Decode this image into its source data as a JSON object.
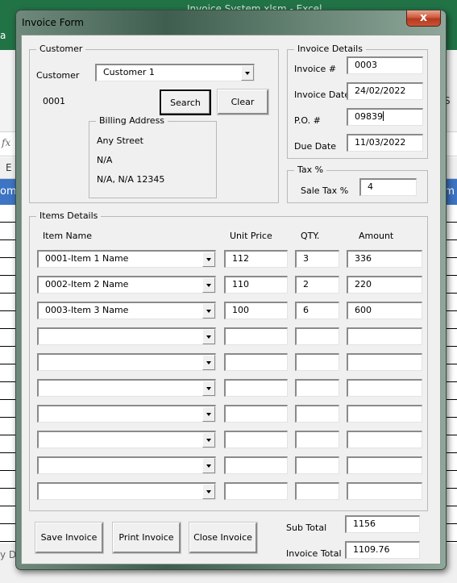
{
  "excel": {
    "title": "Invoice System.xlsm  -  Excel",
    "fragments": {
      "left_tab": "a",
      "formula_icon": "fx",
      "column_e": "E",
      "header_left": "om",
      "header_right": "m",
      "status_left": "y D",
      "ribbon_right_1": "s",
      "ribbon_right_2": "S"
    }
  },
  "dialog": {
    "title": "Invoice Form",
    "close_label": "x",
    "customer_frame": {
      "legend": "Customer",
      "customer_label": "Customer",
      "customer_value": "Customer 1",
      "customer_id": "0001",
      "search_label": "Search",
      "clear_label": "Clear",
      "billing": {
        "legend": "Billing Address",
        "line1": "Any Street",
        "line2": "N/A",
        "line3": "N/A, N/A  12345"
      }
    },
    "invoice_details": {
      "legend": "Invoice Details",
      "fields": [
        {
          "label": "Invoice #",
          "value": "0003"
        },
        {
          "label": "Invoice Date",
          "value": "24/02/2022"
        },
        {
          "label": "P.O. #",
          "value": "09839"
        },
        {
          "label": "Due Date",
          "value": "11/03/2022"
        }
      ]
    },
    "tax": {
      "legend": "Tax %",
      "label": "Sale Tax %",
      "value": "4"
    },
    "items": {
      "legend": "Items Details",
      "headers": {
        "item_name": "Item Name",
        "unit_price": "Unit Price",
        "qty": "QTY.",
        "amount": "Amount"
      },
      "rows": [
        {
          "name": "0001-Item 1 Name",
          "price": "112",
          "qty": "3",
          "amount": "336"
        },
        {
          "name": "0002-Item 2 Name",
          "price": "110",
          "qty": "2",
          "amount": "220"
        },
        {
          "name": "0003-Item 3 Name",
          "price": "100",
          "qty": "6",
          "amount": "600"
        },
        {
          "name": "",
          "price": "",
          "qty": "",
          "amount": ""
        },
        {
          "name": "",
          "price": "",
          "qty": "",
          "amount": ""
        },
        {
          "name": "",
          "price": "",
          "qty": "",
          "amount": ""
        },
        {
          "name": "",
          "price": "",
          "qty": "",
          "amount": ""
        },
        {
          "name": "",
          "price": "",
          "qty": "",
          "amount": ""
        },
        {
          "name": "",
          "price": "",
          "qty": "",
          "amount": ""
        },
        {
          "name": "",
          "price": "",
          "qty": "",
          "amount": ""
        }
      ]
    },
    "footer": {
      "save_label": "Save Invoice",
      "print_label": "Print Invoice",
      "close_label": "Close Invoice",
      "subtotal_label": "Sub Total",
      "subtotal_value": "1156",
      "total_label": "Invoice Total",
      "total_value": "1109.76"
    }
  }
}
